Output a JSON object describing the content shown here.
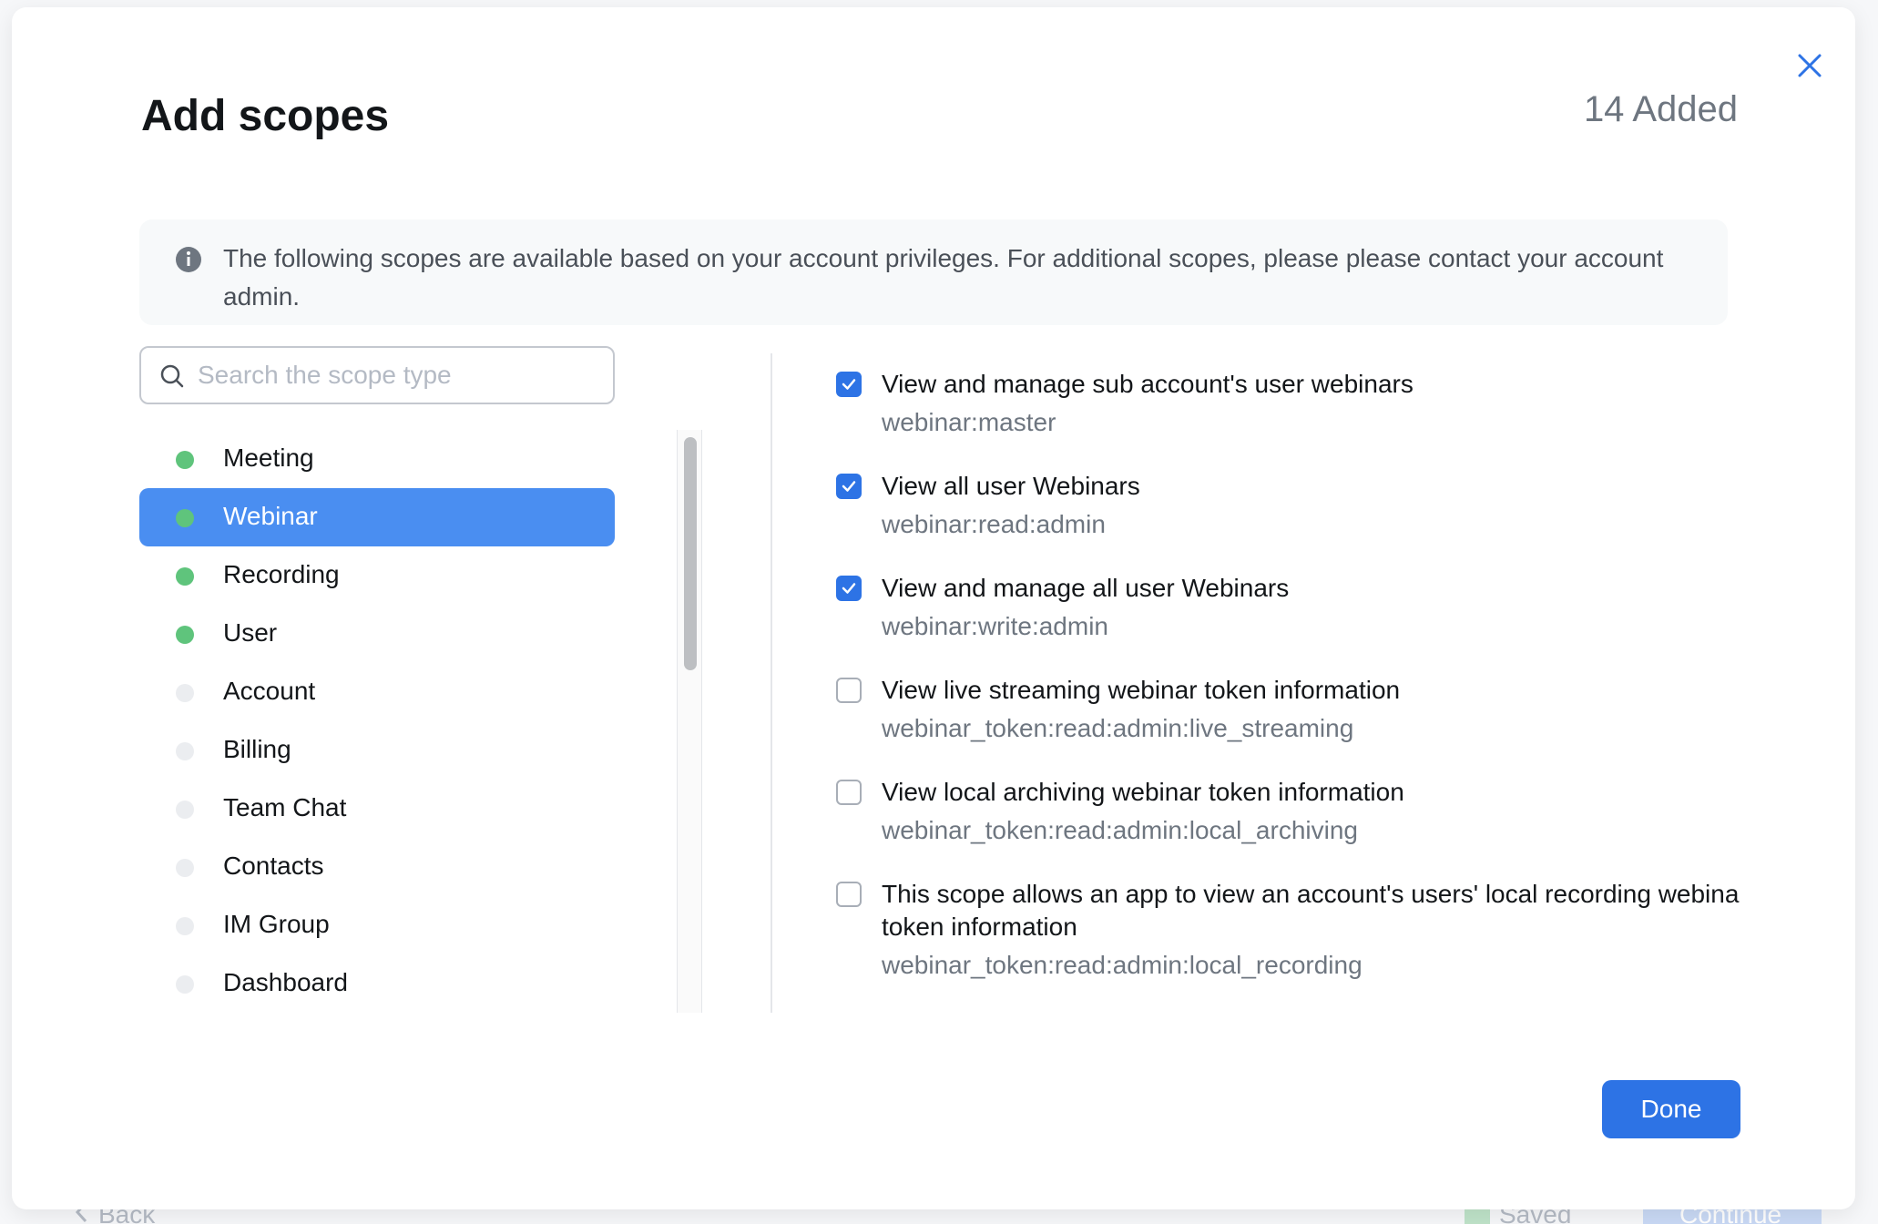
{
  "background": {
    "back_label": "Back",
    "saved_label": "Saved",
    "continue_label": "Continue"
  },
  "modal": {
    "title": "Add scopes",
    "added_count": "14 Added",
    "notice": "The following scopes are available based on your account privileges. For additional scopes, please please contact your account admin.",
    "search": {
      "placeholder": "Search the scope type",
      "value": ""
    },
    "categories": [
      {
        "label": "Meeting",
        "status": "active"
      },
      {
        "label": "Webinar",
        "status": "active",
        "selected": true
      },
      {
        "label": "Recording",
        "status": "active"
      },
      {
        "label": "User",
        "status": "active"
      },
      {
        "label": "Account",
        "status": "inactive"
      },
      {
        "label": "Billing",
        "status": "inactive"
      },
      {
        "label": "Team Chat",
        "status": "inactive"
      },
      {
        "label": "Contacts",
        "status": "inactive"
      },
      {
        "label": "IM Group",
        "status": "inactive"
      },
      {
        "label": "Dashboard",
        "status": "inactive"
      }
    ],
    "scopes": [
      {
        "name": "View and manage sub account's user webinars",
        "code": "webinar:master",
        "checked": true
      },
      {
        "name": "View all user Webinars",
        "code": "webinar:read:admin",
        "checked": true
      },
      {
        "name": "View and manage all user Webinars",
        "code": "webinar:write:admin",
        "checked": true
      },
      {
        "name": "View live streaming webinar token information",
        "code": "webinar_token:read:admin:live_streaming",
        "checked": false
      },
      {
        "name": "View local archiving webinar token information",
        "code": "webinar_token:read:admin:local_archiving",
        "checked": false
      },
      {
        "name": "This scope allows an app to view an account's users' local recording webina token information",
        "code": "webinar_token:read:admin:local_recording",
        "checked": false
      }
    ],
    "done_label": "Done"
  },
  "colors": {
    "accent": "#2d73e5",
    "selected_row": "#4a8ef1",
    "active_dot": "#5fc47c",
    "inactive_dot": "#ebedf0"
  }
}
